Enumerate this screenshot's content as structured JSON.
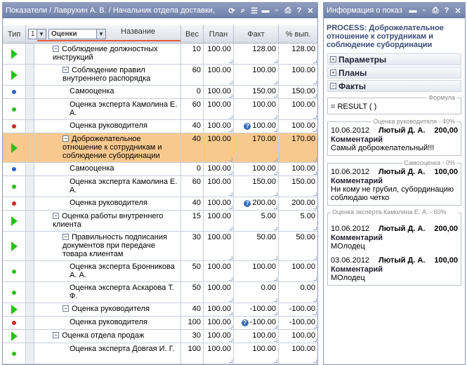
{
  "left_panel": {
    "title": "Показатели / Лаврухин А. В. / Начальник отдела доставки,",
    "columns": {
      "type": "Тип",
      "level": "1",
      "scope": "Оценки",
      "name": "Название",
      "weight": "Вес",
      "plan": "План",
      "fact": "Факт",
      "pct": "% вып."
    },
    "rows": [
      {
        "kind": "tri",
        "indent": 1,
        "exp": "−",
        "name": "Соблюдение должностных инструкций",
        "w": "10",
        "p": "100.00",
        "f": "128.00",
        "pct": "128.00"
      },
      {
        "kind": "tri",
        "indent": 2,
        "exp": "−",
        "name": "Соблюдение правил внутреннего распорядка",
        "w": "60",
        "p": "100.00",
        "f": "100.00",
        "pct": "100.00"
      },
      {
        "kind": "blue",
        "indent": 3,
        "name": "Самооценка",
        "w": "0",
        "p": "100.00",
        "f": "150.00",
        "pct": "150.00"
      },
      {
        "kind": "green",
        "indent": 3,
        "name": "Оценка эксперта Камолина Е. А.",
        "w": "60",
        "p": "100.00",
        "f": "100.00",
        "pct": "100.00"
      },
      {
        "kind": "red",
        "indent": 3,
        "name": "Оценка руководителя",
        "w": "40",
        "p": "100.00",
        "f": "100.00",
        "pct": "100.00",
        "info": true
      },
      {
        "kind": "tri",
        "indent": 2,
        "exp": "−",
        "name": "Доброжелательное отношение к сотрудникам и соблюдение субординации",
        "w": "40",
        "p": "100.00",
        "f": "170.00",
        "pct": "170.00",
        "hl": true
      },
      {
        "kind": "blue",
        "indent": 3,
        "name": "Самооценка",
        "w": "0",
        "p": "100.00",
        "f": "100.00",
        "pct": "100.00"
      },
      {
        "kind": "green",
        "indent": 3,
        "name": "Оценка эксперта Камолина Е. А.",
        "w": "60",
        "p": "100.00",
        "f": "150.00",
        "pct": "150.00"
      },
      {
        "kind": "red",
        "indent": 3,
        "name": "Оценка руководителя",
        "w": "40",
        "p": "100.00",
        "f": "200.00",
        "pct": "200.00",
        "info": true
      },
      {
        "kind": "tri",
        "indent": 1,
        "exp": "−",
        "name": "Оценка работы внутреннего клиента",
        "w": "15",
        "p": "100.00",
        "f": "5.00",
        "pct": "5.00"
      },
      {
        "kind": "tri",
        "indent": 2,
        "exp": "−",
        "name": "Правильность подписания документов при передаче товара клиентам",
        "w": "30",
        "p": "100.00",
        "f": "50.00",
        "pct": "50.00"
      },
      {
        "kind": "green",
        "indent": 3,
        "name": "Оценка эксперта Бронникова А. А.",
        "w": "50",
        "p": "100.00",
        "f": "100.00",
        "pct": "100.00"
      },
      {
        "kind": "green",
        "indent": 3,
        "name": "Оценка эксперта Аскарова Т. Ф.",
        "w": "50",
        "p": "100.00",
        "f": "0.00",
        "pct": "0.00"
      },
      {
        "kind": "tri",
        "indent": 2,
        "exp": "−",
        "name": "Оценка руководителя",
        "w": "40",
        "p": "100.00",
        "f": "-100.00",
        "pct": "-100.00"
      },
      {
        "kind": "red",
        "indent": 3,
        "name": "Оценка руководителя",
        "w": "100",
        "p": "100.00",
        "f": "-100.00",
        "pct": "-100.00",
        "info": true
      },
      {
        "kind": "tri",
        "indent": 1,
        "exp": "−",
        "name": "Оценка отдела продаж",
        "w": "30",
        "p": "100.00",
        "f": "100.00",
        "pct": "100.00"
      },
      {
        "kind": "green",
        "indent": 3,
        "name": "Оценка эксперта Довгая И. Г.",
        "w": "100",
        "p": "100.00",
        "f": "100.00",
        "pct": "100.00"
      }
    ]
  },
  "right_panel": {
    "title": "Информация о показ",
    "process_title": "PROCESS: Доброжелательное отношение к сотрудникам и соблюдение субординации",
    "sections": {
      "params": "Параметры",
      "plans": "Планы",
      "facts": "Факты"
    },
    "formula": {
      "legend": "Формула",
      "text": "= RESULT ( )"
    },
    "groups": [
      {
        "legend": "Оценка руководителя - 40%",
        "entries": [
          {
            "date": "10.06.2012",
            "author": "Лютый Д. А.",
            "value": "200,00",
            "comment_label": "Комментарий",
            "comment": "Самый доброжелательный!!!"
          }
        ]
      },
      {
        "legend": "Самооценка - 0%",
        "entries": [
          {
            "date": "10.06.2012",
            "author": "Лютый Д. А.",
            "value": "100,00",
            "comment_label": "Комментарий",
            "comment": "Ни кому не грубил, субординацию соблюдаю четко"
          }
        ]
      },
      {
        "legend": "Оценка эксперта Камолина Е. А. - 60%",
        "entries": [
          {
            "date": "10.06.2012",
            "author": "Лютый Д. А.",
            "value": "200,00",
            "comment_label": "Комментарий",
            "comment": "МОлодец"
          },
          {
            "date": "03.06.2012",
            "author": "Лютый Д. А.",
            "value": "100,00",
            "comment_label": "Комментарий",
            "comment": "МОлодец"
          }
        ]
      }
    ]
  },
  "colors": {
    "titlebar": "#7b8bb2",
    "highlight": "#f8c98f",
    "status_green": "#2bbf1a",
    "status_blue": "#2a62c9",
    "status_red": "#c62a2a"
  }
}
